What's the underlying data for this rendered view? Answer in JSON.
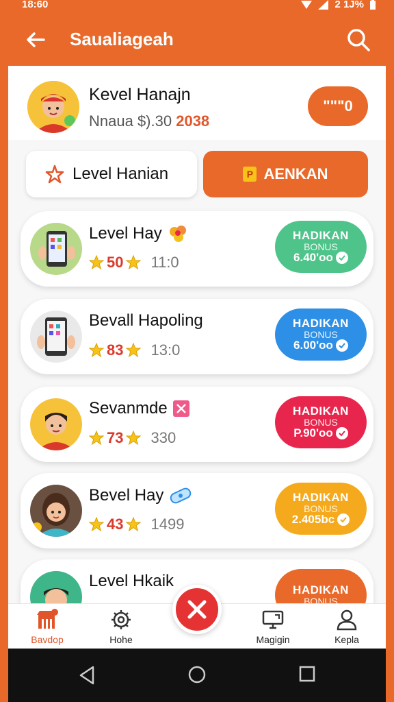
{
  "status": {
    "time": "18:60",
    "battery": "2 1J%"
  },
  "appbar": {
    "title": "Saualiageah"
  },
  "profile": {
    "name": "Kevel Hanajn",
    "sub_prefix": "Nnaua $).30",
    "sub_value": "2038",
    "pill": "\"\"\"0"
  },
  "tabs": {
    "left_label": "Level Hanian",
    "right_label": "AENKAN",
    "right_chip": "P"
  },
  "cards": [
    {
      "name": "Level Hay",
      "score": "50",
      "extra": "11:0",
      "bonus_title": "HADIKAN",
      "bonus_sub": "BONUS",
      "bonus_value": "6.40'oo",
      "color": "#4fc48a"
    },
    {
      "name": "Bevall Hapoling",
      "score": "83",
      "extra": "13:0",
      "bonus_title": "HADIKAN",
      "bonus_sub": "BONUS",
      "bonus_value": "6.00'oo",
      "color": "#2e8fe6"
    },
    {
      "name": "Sevanmde",
      "score": "73",
      "extra": "330",
      "bonus_title": "HADIKAN",
      "bonus_sub": "BONUS",
      "bonus_value": "P.90'oo",
      "color": "#e8264d"
    },
    {
      "name": "Bevel Hay",
      "score": "43",
      "extra": "1499",
      "bonus_title": "HADIKAN",
      "bonus_sub": "BONUS",
      "bonus_value": "2.405bc",
      "color": "#f5a91c"
    },
    {
      "name": "Level Hkaik",
      "score": "",
      "extra": "",
      "bonus_title": "HADIKAN",
      "bonus_sub": "BONUS",
      "bonus_value": "",
      "color": "#e8692a"
    }
  ],
  "nav": {
    "item1": "Bavdop",
    "item2": "Hohe",
    "item3": "Magigin",
    "item4": "Kepla"
  },
  "colors": {
    "accent": "#e8692a",
    "fab": "#e53232"
  }
}
